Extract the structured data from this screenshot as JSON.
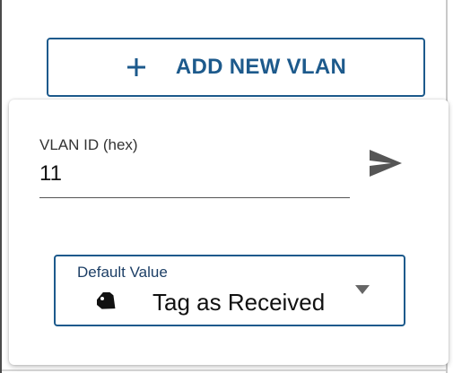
{
  "add_button": {
    "label": "ADD NEW VLAN",
    "icon": "plus-icon"
  },
  "vlan_field": {
    "label": "VLAN ID (hex)",
    "value": "11"
  },
  "send_button": {
    "icon": "send-icon"
  },
  "default_select": {
    "label": "Default Value",
    "icon": "tag-icon",
    "selected": "Tag as Received"
  },
  "colors": {
    "accent": "#1d5a8c",
    "text": "#111111",
    "send_icon": "#555555"
  }
}
